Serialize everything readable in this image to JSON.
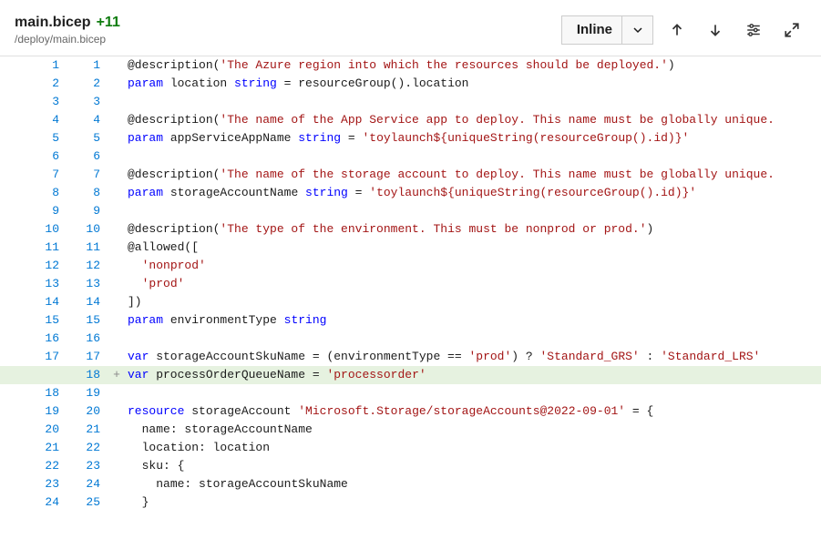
{
  "file": {
    "name": "main.bicep",
    "diffCount": "+11",
    "path": "/deploy/main.bicep"
  },
  "toolbar": {
    "viewMode": "Inline"
  },
  "code": {
    "l1": {
      "old": "1",
      "new": "1",
      "t0": "@description(",
      "s0": "'The Azure region into which the resources should be deployed.'",
      "t1": ")"
    },
    "l2": {
      "old": "2",
      "new": "2",
      "kw": "param",
      "id": " location ",
      "ty": "string",
      "rest": " = resourceGroup().location"
    },
    "l3": {
      "old": "3",
      "new": "3"
    },
    "l4": {
      "old": "4",
      "new": "4",
      "t0": "@description(",
      "s0": "'The name of the App Service app to deploy. This name must be globally unique.",
      "t1": ""
    },
    "l5": {
      "old": "5",
      "new": "5",
      "kw": "param",
      "id": " appServiceAppName ",
      "ty": "string",
      "eq": " = ",
      "s0": "'toylaunch${uniqueString(resourceGroup().id)}'"
    },
    "l6": {
      "old": "6",
      "new": "6"
    },
    "l7": {
      "old": "7",
      "new": "7",
      "t0": "@description(",
      "s0": "'The name of the storage account to deploy. This name must be globally unique.",
      "t1": ""
    },
    "l8": {
      "old": "8",
      "new": "8",
      "kw": "param",
      "id": " storageAccountName ",
      "ty": "string",
      "eq": " = ",
      "s0": "'toylaunch${uniqueString(resourceGroup().id)}'"
    },
    "l9": {
      "old": "9",
      "new": "9"
    },
    "l10": {
      "old": "10",
      "new": "10",
      "t0": "@description(",
      "s0": "'The type of the environment. This must be nonprod or prod.'",
      "t1": ")"
    },
    "l11": {
      "old": "11",
      "new": "11",
      "t0": "@allowed(["
    },
    "l12": {
      "old": "12",
      "new": "12",
      "pad": "  ",
      "s0": "'nonprod'"
    },
    "l13": {
      "old": "13",
      "new": "13",
      "pad": "  ",
      "s0": "'prod'"
    },
    "l14": {
      "old": "14",
      "new": "14",
      "t0": "])"
    },
    "l15": {
      "old": "15",
      "new": "15",
      "kw": "param",
      "id": " environmentType ",
      "ty": "string"
    },
    "l16": {
      "old": "16",
      "new": "16"
    },
    "l17": {
      "old": "17",
      "new": "17",
      "kw": "var",
      "id": " storageAccountSkuName = (environmentType == ",
      "s0": "'prod'",
      "mid": ") ? ",
      "s1": "'Standard_GRS'",
      "mid2": " : ",
      "s2": "'Standard_LRS'"
    },
    "l18": {
      "old": "",
      "new": "18",
      "sign": "+",
      "kw": "var",
      "id": " processOrderQueueName = ",
      "s0": "'processorder'"
    },
    "l19": {
      "old": "18",
      "new": "19"
    },
    "l20": {
      "old": "19",
      "new": "20",
      "kw": "resource",
      "id": " storageAccount ",
      "s0": "'Microsoft.Storage/storageAccounts@2022-09-01'",
      "rest": " = {"
    },
    "l21": {
      "old": "20",
      "new": "21",
      "pad": "  ",
      "t0": "name: storageAccountName"
    },
    "l22": {
      "old": "21",
      "new": "22",
      "pad": "  ",
      "t0": "location: location"
    },
    "l23": {
      "old": "22",
      "new": "23",
      "pad": "  ",
      "t0": "sku: {"
    },
    "l24": {
      "old": "23",
      "new": "24",
      "pad": "    ",
      "t0": "name: storageAccountSkuName"
    },
    "l25": {
      "old": "24",
      "new": "25",
      "pad": "  ",
      "t0": "}"
    }
  }
}
